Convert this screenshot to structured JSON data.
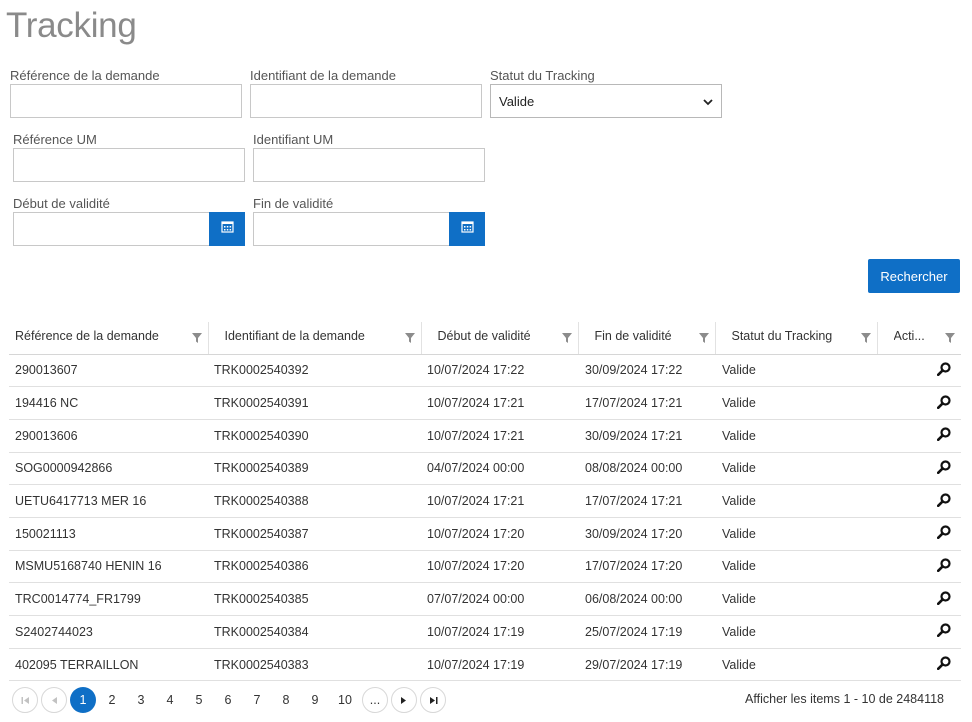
{
  "page": {
    "title": "Tracking"
  },
  "form": {
    "ref_demande_label": "Référence de la demande",
    "id_demande_label": "Identifiant de la demande",
    "statut_label": "Statut du Tracking",
    "statut_value": "Valide",
    "ref_um_label": "Référence UM",
    "id_um_label": "Identifiant UM",
    "debut_label": "Début de validité",
    "fin_label": "Fin de validité",
    "search_button": "Rechercher"
  },
  "grid": {
    "columns": [
      "Référence de la demande",
      "Identifiant de la demande",
      "Début de validité",
      "Fin de validité",
      "Statut du Tracking",
      "Acti..."
    ],
    "rows": [
      [
        "290013607",
        "TRK0002540392",
        "10/07/2024 17:22",
        "30/09/2024 17:22",
        "Valide"
      ],
      [
        "194416 NC",
        "TRK0002540391",
        "10/07/2024 17:21",
        "17/07/2024 17:21",
        "Valide"
      ],
      [
        "290013606",
        "TRK0002540390",
        "10/07/2024 17:21",
        "30/09/2024 17:21",
        "Valide"
      ],
      [
        "SOG0000942866",
        "TRK0002540389",
        "04/07/2024 00:00",
        "08/08/2024 00:00",
        "Valide"
      ],
      [
        "UETU6417713 MER 16",
        "TRK0002540388",
        "10/07/2024 17:21",
        "17/07/2024 17:21",
        "Valide"
      ],
      [
        "150021113",
        "TRK0002540387",
        "10/07/2024 17:20",
        "30/09/2024 17:20",
        "Valide"
      ],
      [
        "MSMU5168740 HENIN 16",
        "TRK0002540386",
        "10/07/2024 17:20",
        "17/07/2024 17:20",
        "Valide"
      ],
      [
        "TRC0014774_FR1799",
        "TRK0002540385",
        "07/07/2024 00:00",
        "06/08/2024 00:00",
        "Valide"
      ],
      [
        "S2402744023",
        "TRK0002540384",
        "10/07/2024 17:19",
        "25/07/2024 17:19",
        "Valide"
      ],
      [
        "402095 TERRAILLON",
        "TRK0002540383",
        "10/07/2024 17:19",
        "29/07/2024 17:19",
        "Valide"
      ]
    ]
  },
  "pager": {
    "pages": [
      "1",
      "2",
      "3",
      "4",
      "5",
      "6",
      "7",
      "8",
      "9",
      "10"
    ],
    "ellipsis": "...",
    "current": "1",
    "info": "Afficher les items 1 - 10 de 2484118"
  },
  "icons": {
    "filter": "filter-icon",
    "calendar": "calendar-icon",
    "view": "magnifier-icon",
    "first": "first-page-icon",
    "prev": "prev-page-icon",
    "next": "next-page-icon",
    "last": "last-page-icon"
  },
  "colors": {
    "accent": "#0f6fc6",
    "title": "#8a8a8a"
  }
}
